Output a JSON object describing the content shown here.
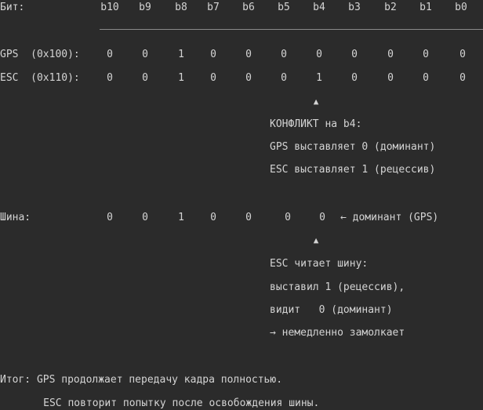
{
  "header": {
    "label": "Бит:",
    "bits": [
      "b10",
      "b9",
      "b8",
      "b7",
      "b6",
      "b5",
      "b4",
      "b3",
      "b2",
      "b1",
      "b0"
    ]
  },
  "rows": [
    {
      "label": "GPS  (0x100):",
      "values": [
        "0",
        "0",
        "1",
        "0",
        "0",
        "0",
        "0",
        "0",
        "0",
        "0",
        "0"
      ]
    },
    {
      "label": "ESC  (0x110):",
      "values": [
        "0",
        "0",
        "1",
        "0",
        "0",
        "0",
        "1",
        "0",
        "0",
        "0",
        "0"
      ]
    }
  ],
  "arrow_glyph": "▲",
  "conflict": {
    "title": "КОНФЛИКТ на b4:",
    "lines": [
      "GPS выставляет 0 (доминант)",
      "ESC выставляет 1 (рецессив)"
    ]
  },
  "bus": {
    "label": "Шина:",
    "values": [
      "0",
      "0",
      "1",
      "0",
      "0",
      "0",
      "0"
    ],
    "note": "← доминант (GPS)"
  },
  "esc_reads": {
    "lines": [
      "ESC читает шину:",
      "выставил 1 (рецессив),",
      "видит   0 (доминант)",
      "→ немедленно замолкает"
    ]
  },
  "summary": {
    "lines": [
      "Итог: GPS продолжает передачу кадра полностью.",
      "     ESC повторит попытку после освобождения шины."
    ]
  }
}
